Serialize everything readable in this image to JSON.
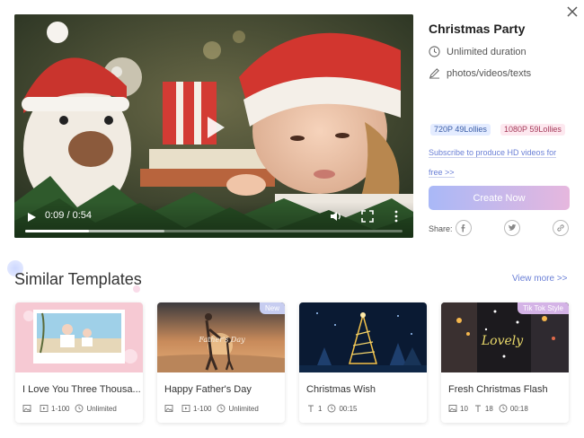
{
  "header": {
    "close_icon": "close-icon"
  },
  "video": {
    "current_time": "0:09",
    "duration": "0:54",
    "time_display": "0:09 / 0:54",
    "progress": 0.17,
    "buffered": 0.37
  },
  "template": {
    "title": "Christmas Party",
    "duration_text": "Unlimited duration",
    "media_text": "photos/videos/texts",
    "price_720": "720P 49Lollies",
    "price_1080": "1080P 59Lollies",
    "subscribe_text": "Subscribe to produce HD videos for free >>",
    "create_label": "Create Now",
    "share_label": "Share:"
  },
  "similar": {
    "title": "Similar Templates",
    "view_more": "View more >>",
    "cards": [
      {
        "name": "I Love You Three Thousa...",
        "tag": "",
        "meta": [
          "1-100",
          "Unlimited"
        ]
      },
      {
        "name": "Happy Father's Day",
        "tag": "New",
        "meta": [
          "1-100",
          "Unlimited"
        ],
        "thumb_text": "Father's Day"
      },
      {
        "name": "Christmas Wish",
        "tag": "",
        "meta": [
          "1",
          "00:15"
        ]
      },
      {
        "name": "Fresh Christmas Flash",
        "tag": "Tik Tok Style",
        "meta": [
          "10",
          "18",
          "00:18"
        ],
        "thumb_text": "Lovely"
      }
    ]
  },
  "colors": {
    "accent": "#6a7fd6",
    "button_from": "#a9b8f7",
    "button_to": "#e6b7de"
  }
}
